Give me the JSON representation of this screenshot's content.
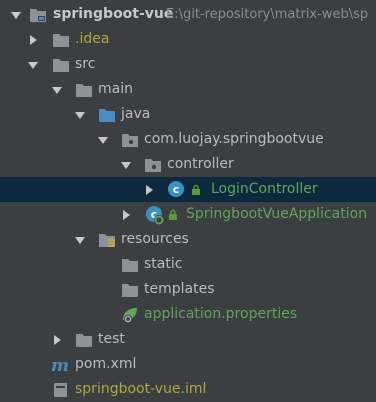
{
  "project": {
    "name": "springboot-vue",
    "path": "E:\\git-repository\\matrix-web\\sp"
  },
  "tree": {
    "idea": ".idea",
    "src": "src",
    "main": "main",
    "java": "java",
    "package": "com.luojay.springbootvue",
    "controller": "controller",
    "login_controller": "LoginController",
    "app_class": "SpringbootVueApplication",
    "resources": "resources",
    "static": "static",
    "templates": "templates",
    "app_properties": "application.properties",
    "test": "test",
    "pom": "pom.xml",
    "iml": "springboot-vue.iml"
  },
  "colors": {
    "background": "#3c3f41",
    "selection": "#0d293e",
    "text": "#bbbbbb",
    "excluded_text": "#b3a63c",
    "class_text": "#62a658",
    "folder": "#8b9399",
    "source_folder": "#4a8cbf",
    "class_icon": "#3592c4",
    "lock_icon": "#5e9a35",
    "maven_icon": "#4a8cbf"
  },
  "icons": {
    "folder": "folder-icon",
    "source_folder": "source-folder-icon",
    "resources_folder": "resources-folder-icon",
    "package": "package-icon",
    "java_class": "java-class-icon",
    "spring_boot_class": "spring-boot-class-icon",
    "properties_file": "properties-file-icon",
    "maven_file": "maven-icon",
    "module_file": "module-file-icon"
  }
}
